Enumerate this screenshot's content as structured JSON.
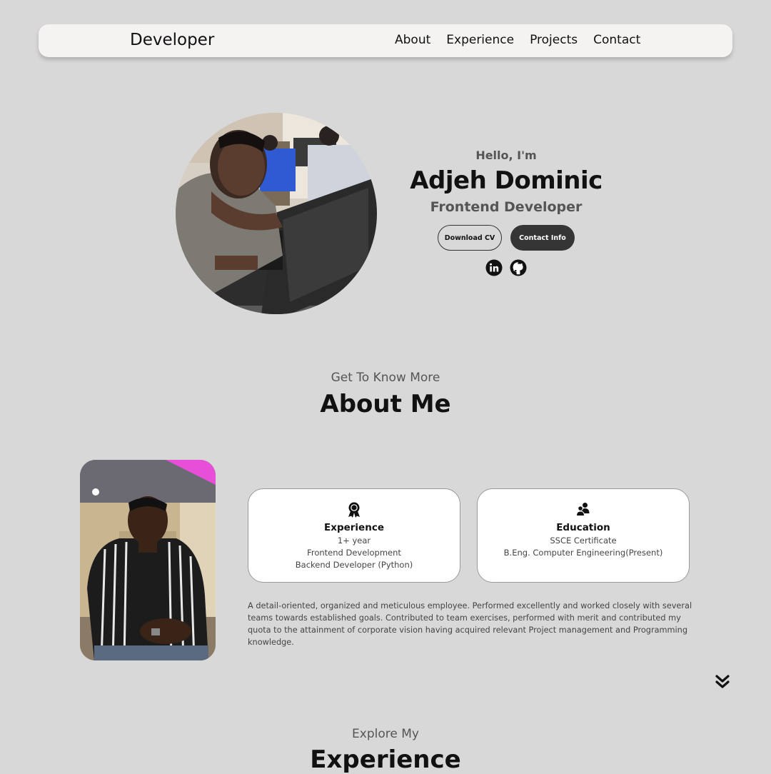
{
  "nav": {
    "logo": "Developer",
    "links": [
      "About",
      "Experience",
      "Projects",
      "Contact"
    ]
  },
  "hero": {
    "greeting": "Hello, I'm",
    "name": "Adjeh Dominic",
    "role": "Frontend Developer",
    "download_cv": "Download CV",
    "contact_info": "Contact Info",
    "socials": [
      "linkedin-icon",
      "github-icon"
    ]
  },
  "about": {
    "subtitle": "Get To Know More",
    "title": "About Me",
    "experience": {
      "title": "Experience",
      "lines": [
        "1+ year",
        "Frontend Development",
        "Backend Developer (Python)"
      ]
    },
    "education": {
      "title": "Education",
      "lines": [
        "SSCE Certificate",
        "B.Eng. Computer Engineering(Present)"
      ]
    },
    "paragraph": "A detail-oriented, organized and meticulous employee. Performed excellently and worked closely with several teams towards established goals. Contributed to team exercises, performed with merit and contributed my quota to the attainment of corporate vision having acquired relevant Project management and Programming knowledge."
  },
  "experience_section": {
    "subtitle": "Explore My",
    "title": "Experience"
  },
  "colors": {
    "background": "#d8d8d8",
    "nav_bg": "#f4f3f2",
    "button_dark": "#353535",
    "card_bg": "#ffffff"
  }
}
